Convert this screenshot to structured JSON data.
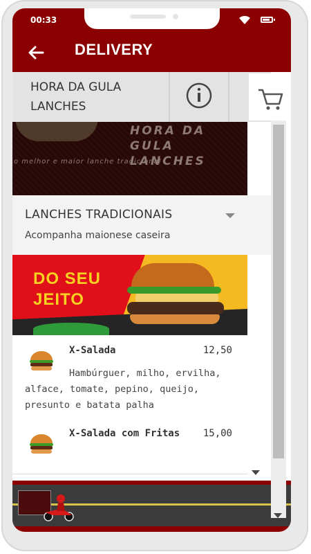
{
  "status": {
    "time": "00:33"
  },
  "appbar": {
    "title": "DELIVERY"
  },
  "store": {
    "name": "HORA DA GULA LANCHES",
    "banner_logo": "HORA DA GULA LANCHES",
    "banner_tagline": "o melhor e maior lanche tradicional"
  },
  "category": {
    "title": "LANCHES TRADICIONAIS",
    "subtitle": "Acompanha maionese caseira"
  },
  "promo": {
    "text": "DO SEU JEITO"
  },
  "items": [
    {
      "name": "X-Salada",
      "price": "12,50",
      "description": "Hambúrguer, milho, ervilha, alface, tomate, pepino, queijo, presunto e batata palha"
    },
    {
      "name": "X-Salada com Fritas",
      "price": "15,00"
    }
  ],
  "colors": {
    "primary": "#8b0000",
    "accent": "#f5d21f"
  }
}
